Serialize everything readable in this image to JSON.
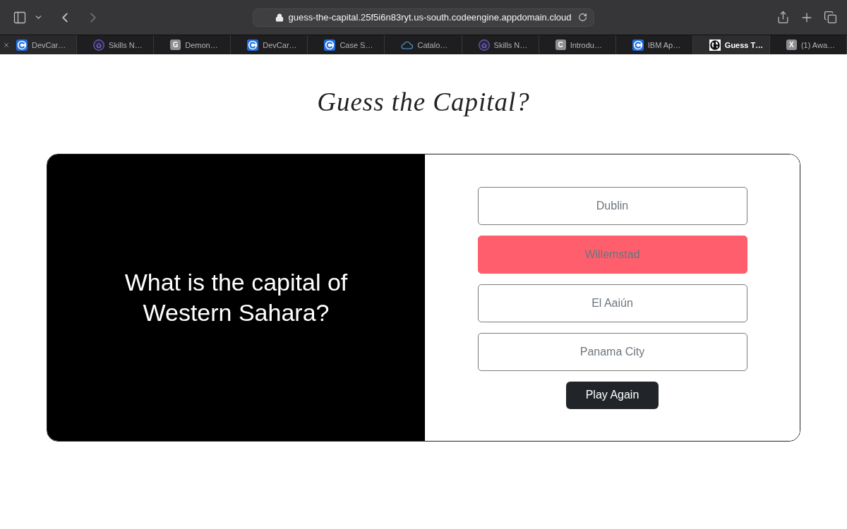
{
  "browser": {
    "toolbar": {
      "back_button": {
        "disabled": false
      },
      "forward_button": {
        "disabled": true
      },
      "address": "guess-the-capital.25f5i6n83ryt.us-south.codeengine.appdomain.cloud"
    },
    "tabs": [
      {
        "label": "DevCar…",
        "favicon": {
          "kind": "c-logo"
        },
        "selected": false,
        "hovered": true
      },
      {
        "label": "Skills N…",
        "favicon": {
          "kind": "ring-logo"
        },
        "selected": false,
        "hovered": false
      },
      {
        "label": "Demon…",
        "favicon": {
          "kind": "letter",
          "letter": "G"
        },
        "selected": false,
        "hovered": false
      },
      {
        "label": "DevCar…",
        "favicon": {
          "kind": "c-logo"
        },
        "selected": false,
        "hovered": false
      },
      {
        "label": "Case S…",
        "favicon": {
          "kind": "c-logo"
        },
        "selected": false,
        "hovered": false
      },
      {
        "label": "Catalo…",
        "favicon": {
          "kind": "cloud"
        },
        "selected": false,
        "hovered": false
      },
      {
        "label": "Skills N…",
        "favicon": {
          "kind": "ring-logo"
        },
        "selected": false,
        "hovered": false
      },
      {
        "label": "Introdu…",
        "favicon": {
          "kind": "letter",
          "letter": "C"
        },
        "selected": false,
        "hovered": false
      },
      {
        "label": "IBM Ap…",
        "favicon": {
          "kind": "c-logo"
        },
        "selected": false,
        "hovered": false
      },
      {
        "label": "Guess T…",
        "favicon": {
          "kind": "globe"
        },
        "selected": true,
        "hovered": false
      },
      {
        "label": "(1) Awa…",
        "favicon": {
          "kind": "letter",
          "letter": "X"
        },
        "selected": false,
        "hovered": false
      }
    ]
  },
  "page": {
    "title": "Guess the Capital?",
    "question": "What is the capital of Western Sahara?",
    "answered_correctly": false,
    "options": [
      {
        "label": "Dublin",
        "selected": false
      },
      {
        "label": "Willemstad",
        "selected": true
      },
      {
        "label": "El Aaiún",
        "selected": false
      },
      {
        "label": "Panama City",
        "selected": false
      }
    ],
    "play_again_button": "Play Again"
  }
}
